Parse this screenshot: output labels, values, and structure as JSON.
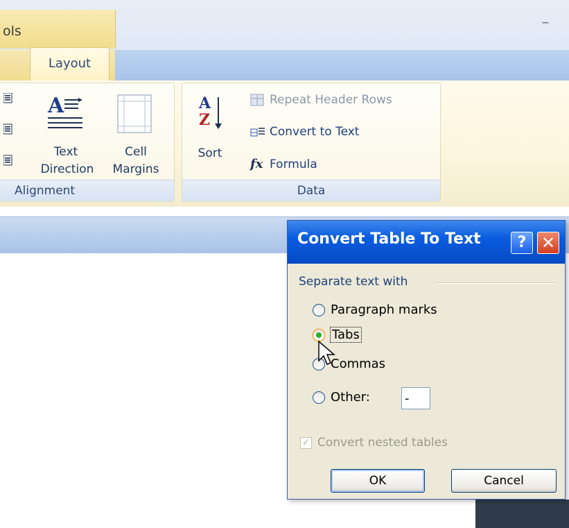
{
  "titlebar": {
    "context_tab_label": "ols",
    "minimize_glyph": "–"
  },
  "tabs": {
    "active": "Layout"
  },
  "ribbon": {
    "alignment_group": {
      "label": "Alignment",
      "text_direction_line1": "Text",
      "text_direction_line2": "Direction",
      "cell_margins_line1": "Cell",
      "cell_margins_line2": "Margins"
    },
    "data_group": {
      "label": "Data",
      "sort_label": "Sort",
      "repeat_header_rows": "Repeat Header Rows",
      "convert_to_text": "Convert to Text",
      "formula": "Formula",
      "formula_icon_text": "fx"
    }
  },
  "dialog": {
    "title": "Convert Table To Text",
    "help_glyph": "?",
    "close_glyph": "✕",
    "group_label": "Separate text with",
    "options": [
      {
        "label": "Paragraph marks",
        "checked": false
      },
      {
        "label": "Tabs",
        "checked": true
      },
      {
        "label": "Commas",
        "checked": false
      },
      {
        "label": "Other:",
        "checked": false
      }
    ],
    "other_value": "-",
    "nested_label": "Convert nested tables",
    "nested_checked": true,
    "ok_label": "OK",
    "cancel_label": "Cancel"
  },
  "colors": {
    "title_blue": "#0a5de0",
    "context_gold": "#f1dd8c",
    "radio_selected": "#2bb32b"
  }
}
